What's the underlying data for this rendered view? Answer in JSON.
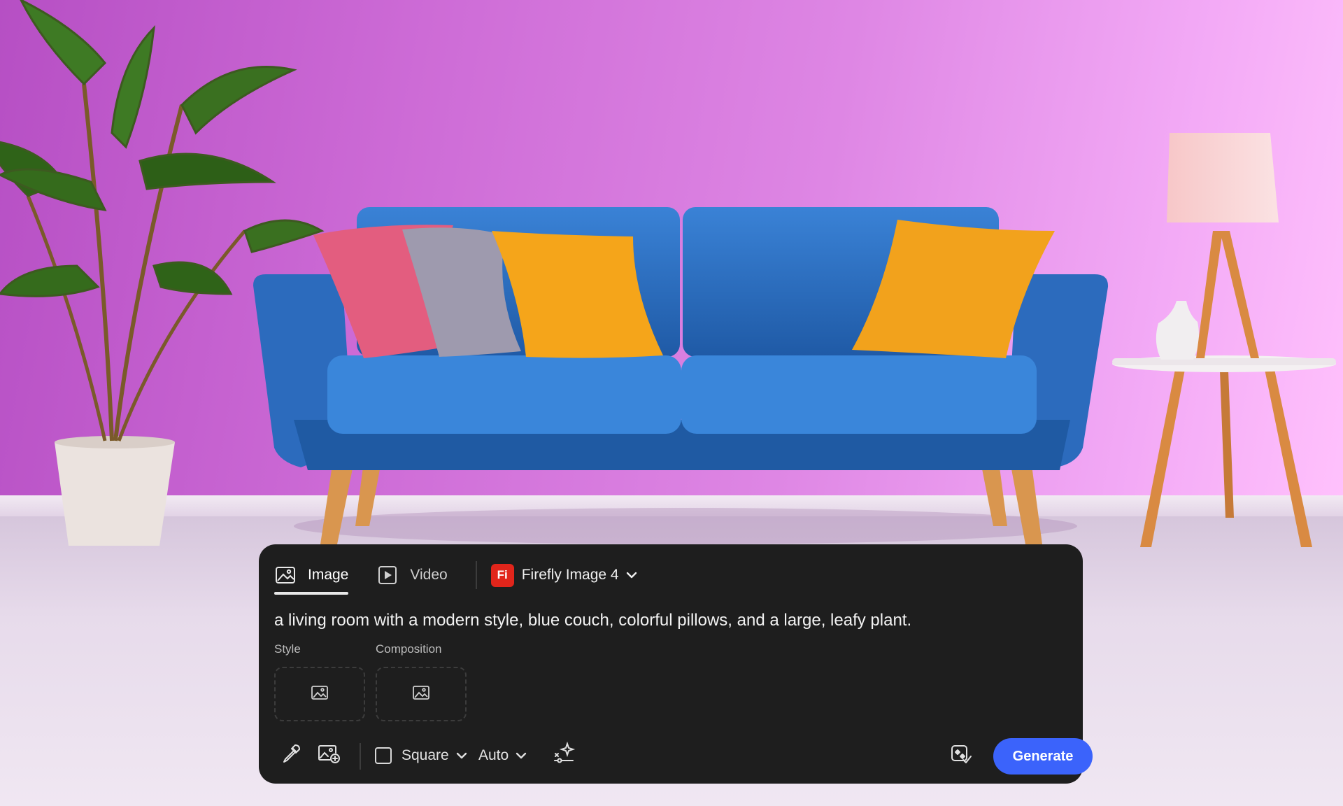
{
  "colors": {
    "panel_bg": "#1e1e1e",
    "accent_blue": "#3b63fb",
    "firefly_red": "#e1251b",
    "wall": "#d57be0",
    "couch": "#2f72c4"
  },
  "tabs": [
    {
      "label": "Image",
      "icon": "image-icon",
      "active": true
    },
    {
      "label": "Video",
      "icon": "video-play-icon",
      "active": false
    }
  ],
  "model": {
    "badge": "Fi",
    "label": "Firefly Image 4"
  },
  "prompt": {
    "text": "a living room with a modern style, blue couch, colorful pillows, and a large, leafy plant."
  },
  "references": [
    {
      "label": "Style",
      "icon": "image-placeholder-icon"
    },
    {
      "label": "Composition",
      "icon": "image-placeholder-icon"
    }
  ],
  "toolbar": {
    "tools": [
      "eyedropper-icon",
      "add-image-icon",
      "sparkle-settings-icon",
      "content-credentials-icon"
    ],
    "aspect": {
      "label": "Square"
    },
    "style": {
      "label": "Auto"
    },
    "generate_label": "Generate"
  }
}
